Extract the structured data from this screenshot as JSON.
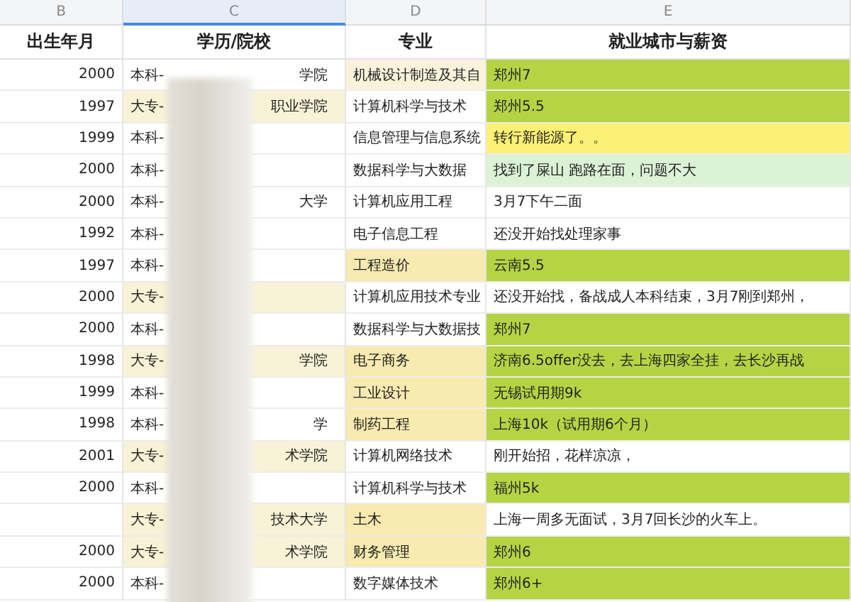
{
  "column_letters": [
    {
      "label": "B",
      "selected": false
    },
    {
      "label": "C",
      "selected": true
    },
    {
      "label": "D",
      "selected": false
    },
    {
      "label": "E",
      "selected": false
    }
  ],
  "headers": [
    "出生年月",
    "学历/院校",
    "专业",
    "就业城市与薪资"
  ],
  "rows": [
    {
      "year": "2000",
      "school": {
        "left": "本科-",
        "right": "学院",
        "color": "#ffffff"
      },
      "major": {
        "text": "机械设计制造及其自",
        "color": "#faf3dc"
      },
      "outcome": {
        "text": "郑州7",
        "color": "#b5d444"
      }
    },
    {
      "year": "1997",
      "school": {
        "left": "大专-",
        "right": "职业学院",
        "color": "#f8f2d6"
      },
      "major": {
        "text": "计算机科学与技术",
        "color": "#ffffff"
      },
      "outcome": {
        "text": "郑州5.5",
        "color": "#b5d444"
      }
    },
    {
      "year": "1999",
      "school": {
        "left": "本科-",
        "color": "#ffffff"
      },
      "major": {
        "text": "信息管理与信息系统",
        "color": "#ffffff"
      },
      "outcome": {
        "text": "转行新能源了。。",
        "color": "#fdf175"
      }
    },
    {
      "year": "2000",
      "school": {
        "left": "本科-",
        "color": "#ffffff"
      },
      "major": {
        "text": "数据科学与大数据",
        "color": "#ffffff"
      },
      "outcome": {
        "text": "找到了屎山 跑路在面，问题不大",
        "color": "#dcf2d6"
      }
    },
    {
      "year": "2000",
      "school": {
        "left": "本科-",
        "right": "大学",
        "color": "#ffffff"
      },
      "major": {
        "text": "计算机应用工程",
        "color": "#ffffff"
      },
      "outcome": {
        "text": "3月7下午二面",
        "color": "#ffffff"
      }
    },
    {
      "year": "1992",
      "school": {
        "left": "本科-",
        "color": "#ffffff"
      },
      "major": {
        "text": "电子信息工程",
        "color": "#ffffff"
      },
      "outcome": {
        "text": "还没开始找处理家事",
        "color": "#ffffff"
      }
    },
    {
      "year": "1997",
      "school": {
        "left": "本科-",
        "color": "#ffffff"
      },
      "major": {
        "text": "工程造价",
        "color": "#f8eab0"
      },
      "outcome": {
        "text": "云南5.5",
        "color": "#b5d444"
      }
    },
    {
      "year": "2000",
      "school": {
        "left": "大专-",
        "color": "#f8f2d6"
      },
      "major": {
        "text": "计算机应用技术专业",
        "color": "#ffffff"
      },
      "outcome": {
        "text": "还没开始找，备战成人本科结束，3月7刚到郑州，",
        "color": "#ffffff"
      }
    },
    {
      "year": "2000",
      "school": {
        "left": "本科-",
        "color": "#ffffff"
      },
      "major": {
        "text": "数据科学与大数据技",
        "color": "#ffffff"
      },
      "outcome": {
        "text": "郑州7",
        "color": "#b5d444"
      }
    },
    {
      "year": "1998",
      "school": {
        "left": "大专-",
        "right": "学院",
        "color": "#f8f2d6"
      },
      "major": {
        "text": "电子商务",
        "color": "#f8eab0"
      },
      "outcome": {
        "text": "济南6.5offer没去，去上海四家全挂，去长沙再战",
        "color": "#b5d444"
      }
    },
    {
      "year": "1999",
      "school": {
        "left": "本科-",
        "color": "#ffffff"
      },
      "major": {
        "text": "工业设计",
        "color": "#f8eab0"
      },
      "outcome": {
        "text": "无锡试用期9k",
        "color": "#b5d444"
      }
    },
    {
      "year": "1998",
      "school": {
        "left": "本科-",
        "right": "学",
        "color": "#ffffff"
      },
      "major": {
        "text": "制药工程",
        "color": "#f8eab0"
      },
      "outcome": {
        "text": "上海10k（试用期6个月）",
        "color": "#b5d444"
      }
    },
    {
      "year": "2001",
      "school": {
        "left": "大专-",
        "right": "术学院",
        "color": "#f8f2d6"
      },
      "major": {
        "text": "计算机网络技术",
        "color": "#ffffff"
      },
      "outcome": {
        "text": "刚开始招，花样凉凉，",
        "color": "#ffffff"
      }
    },
    {
      "year": "2000",
      "school": {
        "left": "本科-",
        "color": "#ffffff"
      },
      "major": {
        "text": "计算机科学与技术",
        "color": "#ffffff"
      },
      "outcome": {
        "text": "福州5k",
        "color": "#b5d444"
      }
    },
    {
      "school": {
        "left": "大专-",
        "right": "技术大学",
        "color": "#f8f2d6"
      },
      "major": {
        "text": "土木",
        "color": "#f8eab0"
      },
      "outcome": {
        "text": "上海一周多无面试，3月7回长沙的火车上。",
        "color": "#ffffff"
      }
    },
    {
      "year": "2000",
      "school": {
        "left": "大专-",
        "right": "术学院",
        "color": "#f8f2d6"
      },
      "major": {
        "text": "财务管理",
        "color": "#f8eab0"
      },
      "outcome": {
        "text": "郑州6",
        "color": "#b5d444"
      }
    },
    {
      "year": "2000",
      "school": {
        "left": "本科-",
        "color": "#ffffff"
      },
      "major": {
        "text": "数字媒体技术",
        "color": "#ffffff"
      },
      "outcome": {
        "text": "郑州6+",
        "color": "#b5d444"
      }
    }
  ]
}
